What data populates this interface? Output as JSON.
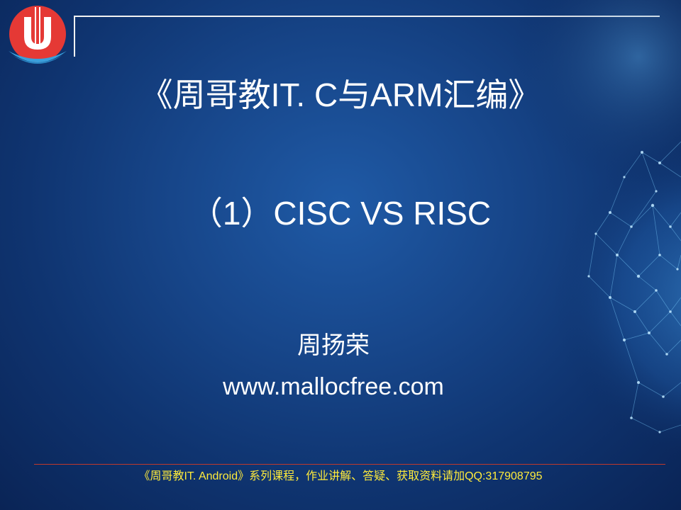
{
  "slide": {
    "title": "《周哥教IT. C与ARM汇编》",
    "subtitle": "（1）CISC VS RISC",
    "author": "周扬荣",
    "website": "www.mallocfree.com",
    "footer": "《周哥教IT. Android》系列课程，作业讲解、答疑、获取资料请加QQ:317908795"
  },
  "colors": {
    "background": "#17468a",
    "text": "#ffffff",
    "footer_text": "#ffeb3b",
    "footer_line": "#c0392b",
    "logo_red": "#e53935",
    "logo_blue": "#3aa0dc"
  },
  "icons": {
    "logo": "mallocfree-logo-icon",
    "decoration": "network-globe-icon"
  }
}
